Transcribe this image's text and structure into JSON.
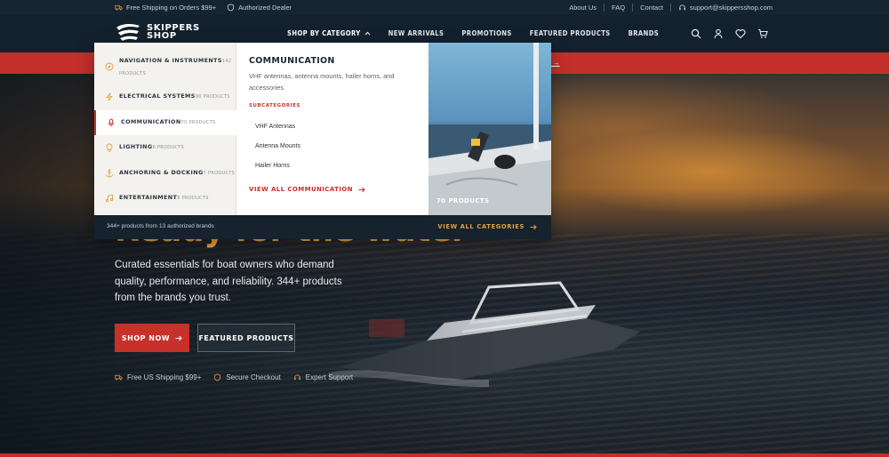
{
  "topbar": {
    "shipping": "Free Shipping on Orders $99+",
    "dealer": "Authorized Dealer",
    "about": "About Us",
    "faq": "FAQ",
    "contact": "Contact",
    "email": "support@skippersshop.com"
  },
  "logo": {
    "line1": "SKIPPERS",
    "line2": "SHOP"
  },
  "nav": {
    "items": [
      {
        "label": "SHOP BY CATEGORY"
      },
      {
        "label": "NEW ARRIVALS"
      },
      {
        "label": "PROMOTIONS"
      },
      {
        "label": "FEATURED PRODUCTS"
      },
      {
        "label": "BRANDS"
      }
    ]
  },
  "promo": {
    "link": "S →"
  },
  "mega": {
    "categories": [
      {
        "name": "NAVIGATION & INSTRUMENTS",
        "count": "142 PRODUCTS",
        "icon": "compass-icon"
      },
      {
        "name": "ELECTRICAL SYSTEMS",
        "count": "90 PRODUCTS",
        "icon": "lightning-icon"
      },
      {
        "name": "COMMUNICATION",
        "count": "70 PRODUCTS",
        "icon": "microphone-icon"
      },
      {
        "name": "LIGHTING",
        "count": "6 PRODUCTS",
        "icon": "bulb-icon"
      },
      {
        "name": "ANCHORING & DOCKING",
        "count": "7 PRODUCTS",
        "icon": "anchor-icon"
      },
      {
        "name": "ENTERTAINMENT",
        "count": "8 PRODUCTS",
        "icon": "music-icon"
      }
    ],
    "detail": {
      "title": "COMMUNICATION",
      "description": "VHF antennas, antenna mounts, hailer horns, and accessories",
      "subheading": "SUBCATEGORIES",
      "subcategories": [
        "VHF Antennas",
        "Antenna Mounts",
        "Hailer Horns"
      ],
      "view_all": "VIEW ALL COMMUNICATION"
    },
    "image_count": "70 PRODUCTS",
    "footer_info": "344+ products from 13 authorized brands",
    "footer_link": "VIEW ALL CATEGORIES"
  },
  "hero": {
    "title": "Ready for the water",
    "subtitle": "Curated essentials for boat owners who demand quality, performance, and reliability. 344+ products from the brands you trust.",
    "shop_now": "SHOP NOW",
    "featured": "FEATURED PRODUCTS",
    "trust": [
      "Free US Shipping $99+",
      "Secure Checkout",
      "Expert Support"
    ]
  },
  "colors": {
    "accent": "#c8302a",
    "gold": "#e8a33a",
    "navy": "#13212e"
  }
}
